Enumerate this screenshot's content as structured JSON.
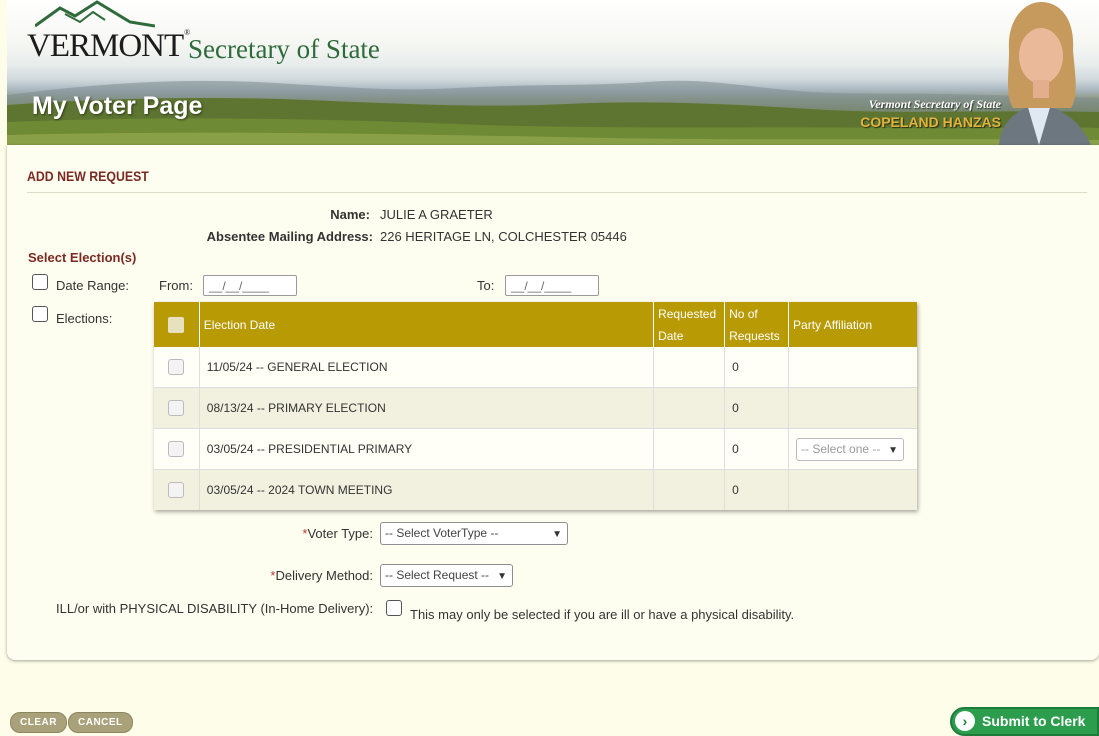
{
  "header": {
    "state_wordmark": "VERMONT",
    "agency": "Secretary of State",
    "page_title": "My Voter Page",
    "official_caption": "Vermont Secretary of State",
    "official_name": "COPELAND HANZAS"
  },
  "request": {
    "section_title": "ADD NEW REQUEST",
    "name_label": "Name:",
    "name_value": "JULIE A GRAETER",
    "address_label": "Absentee Mailing Address:",
    "address_value": "226 HERITAGE LN, COLCHESTER 05446",
    "select_elections_label": "Select Election(s)",
    "date_range_label": "Date Range:",
    "from_label": "From:",
    "to_label": "To:",
    "from_value": "__/__/____",
    "to_value": "__/__/____",
    "elections_label": "Elections:"
  },
  "elections_table": {
    "columns": [
      "Election Date",
      "Requested Date",
      "No of Requests",
      "Party Affiliation"
    ],
    "rows": [
      {
        "election": "11/05/24 -- GENERAL ELECTION",
        "requested": "",
        "count": "0",
        "party": ""
      },
      {
        "election": "08/13/24 -- PRIMARY ELECTION",
        "requested": "",
        "count": "0",
        "party": ""
      },
      {
        "election": "03/05/24 -- PRESIDENTIAL PRIMARY",
        "requested": "",
        "count": "0",
        "party": "-- Select one --"
      },
      {
        "election": "03/05/24 -- 2024 TOWN MEETING",
        "requested": "",
        "count": "0",
        "party": ""
      }
    ]
  },
  "form": {
    "voter_type_label": "Voter Type:",
    "voter_type_value": "-- Select VoterType --",
    "delivery_label": "Delivery Method:",
    "delivery_value": "-- Select Request --",
    "required_marker": "*",
    "disability_label": "ILL/or with PHYSICAL DISABILITY (In-Home Delivery):",
    "disability_note": "This may only be selected if you are ill or have a physical disability."
  },
  "actions": {
    "clear": "CLEAR",
    "cancel": "CANCEL",
    "submit": "Submit to Clerk"
  },
  "colors": {
    "table_header": "#b89a04",
    "section_title": "#7a2a22",
    "submit": "#2c9d4d",
    "page_bg": "#fdfde9"
  }
}
